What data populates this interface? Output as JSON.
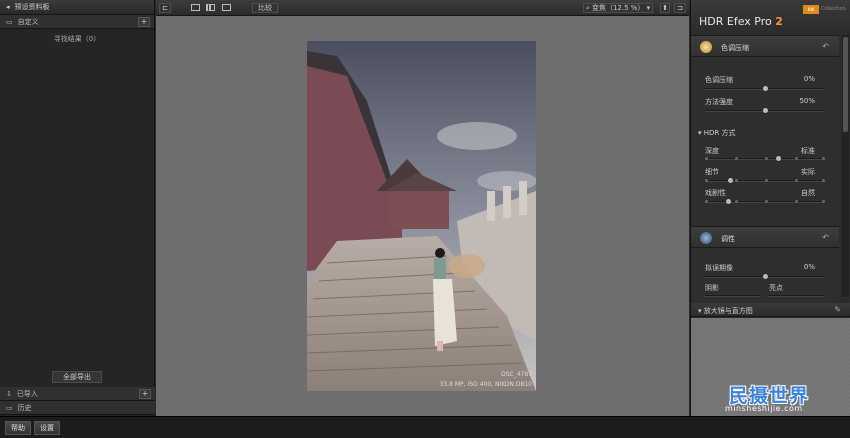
{
  "left_panel": {
    "header": "预设资料板",
    "custom": "自定义",
    "search_result": "寻找结果（0）",
    "export_all": "全部导出",
    "imported": "已导入",
    "history": "历史",
    "plus": "+"
  },
  "toolbar": {
    "compare": "比较",
    "zoom_label": "变焦（12.5 %）"
  },
  "photo": {
    "filename": "DSC_4787",
    "info": "33.8 MP, ISO 400, NIKON D810"
  },
  "right_panel": {
    "title": "HDR Efex Pro",
    "title_version": "2",
    "brand_badge": "NIK",
    "brand_text": "Collection",
    "tone_section": "色调压缩",
    "tone_compression_label": "色调压缩",
    "tone_compression_value": "0%",
    "tone_compression_level": 0.5,
    "method_strength_label": "方法强度",
    "method_strength_value": "50%",
    "method_strength_level": 0.5,
    "hdr_method": "HDR 方式",
    "depth_label": "深度",
    "depth_value": "标准",
    "depth_level": 0.62,
    "detail_label": "细节",
    "detail_value": "实际",
    "detail_level": 0.2,
    "drama_label": "戏剧性",
    "drama_value": "自然",
    "drama_level": 0.18,
    "toning_section": "调性",
    "exposure_label": "拟误期像",
    "exposure_value": "0%",
    "exposure_level": 0.5,
    "shadows_label": "阴影",
    "highlights_label": "亮点",
    "magnifier": "放大镜与直方图",
    "watermark": "民摄世界",
    "watermark_url": "minsheshijie.com",
    "undo_glyph": "↶"
  },
  "bottom": {
    "help": "帮助",
    "settings": "设置"
  },
  "colors": {
    "accent": "#f29a2b",
    "watermark": "#3a83d8"
  }
}
